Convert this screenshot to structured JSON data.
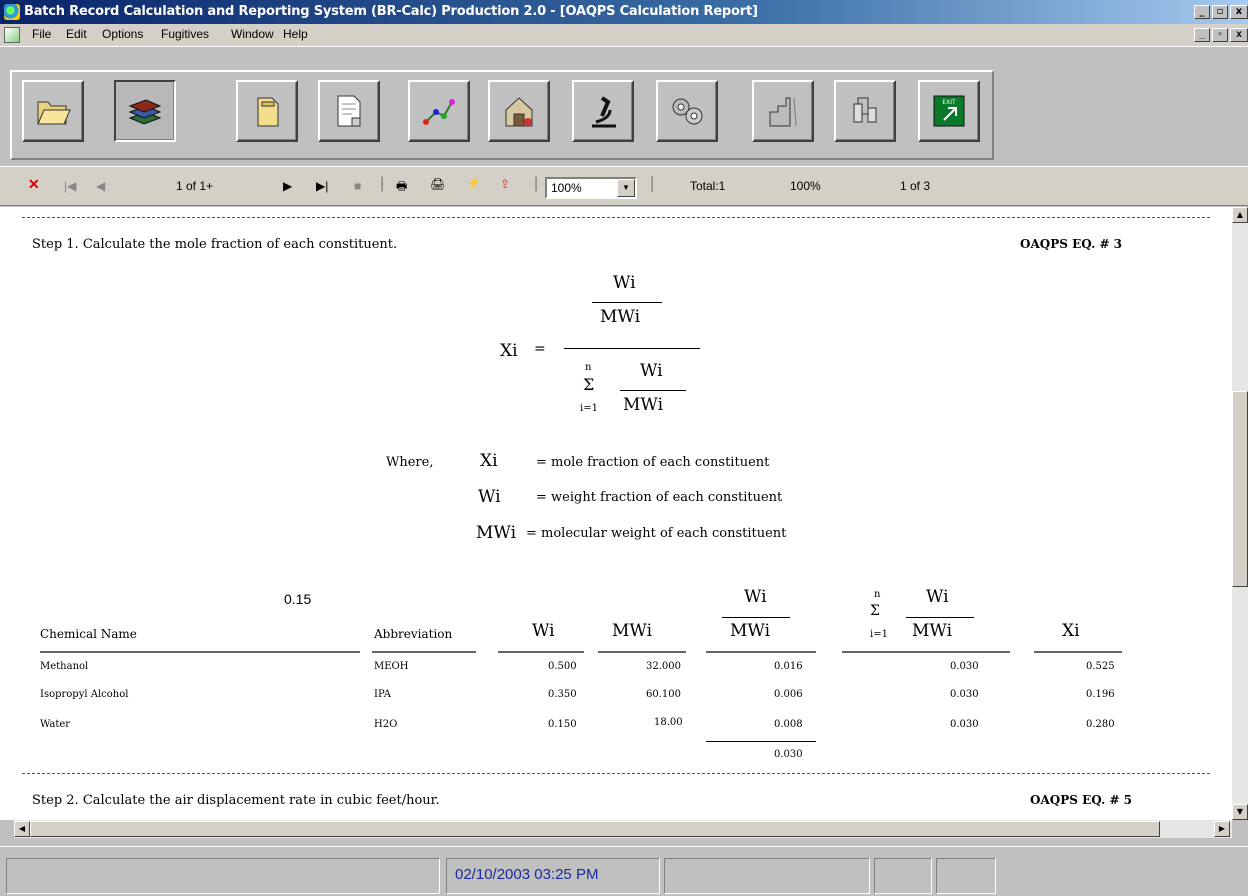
{
  "window": {
    "title": "Batch Record Calculation and Reporting System (BR-Calc) Production 2.0 - [OAQPS Calculation Report]"
  },
  "menu": {
    "items": [
      "File",
      "Edit",
      "Options",
      "Fugitives",
      "Window",
      "Help"
    ]
  },
  "toolbar": {
    "buttons": [
      "open-folder-icon",
      "books-icon",
      "folder-icon",
      "document-icon",
      "molecule-icon",
      "building-icon",
      "microscope-icon",
      "gears-icon",
      "factory-icon",
      "equipment-icon",
      "exit-icon"
    ],
    "exit_label": "EXIT"
  },
  "nav": {
    "page": "1 of 1+",
    "zoom": "100%",
    "total": "Total:1",
    "percent": "100%",
    "of": "1 of 3"
  },
  "report": {
    "step1": "Step 1.  Calculate the mole fraction of each constituent.",
    "eq1": "OAQPS EQ. # 3",
    "formula": {
      "lhs": "Xi",
      "eq": "=",
      "num": "Wi",
      "den": "MWi",
      "sum": "Σ",
      "n": "n",
      "i1": "i=1",
      "snum": "Wi",
      "sden": "MWi"
    },
    "where": "Where,",
    "defs": [
      {
        "sym": "Xi",
        "text": "= mole fraction of each constituent"
      },
      {
        "sym": "Wi",
        "text": "= weight fraction of each constituent"
      },
      {
        "sym": "MWi",
        "text": "= molecular weight of each constituent"
      }
    ],
    "stray_value": "0.15",
    "headers": {
      "chem": "Chemical Name",
      "abbr": "Abbreviation",
      "w": "Wi",
      "mw": "MWi",
      "wmw_num": "Wi",
      "wmw_den": "MWi",
      "sum_n": "n",
      "sum": "Σ",
      "sum_i": "i=1",
      "swmw_num": "Wi",
      "swmw_den": "MWi",
      "x": "Xi"
    },
    "rows": [
      {
        "name": "Methanol",
        "abbr": "MEOH",
        "w": "0.500",
        "mw": "32.000",
        "wmw": "0.016",
        "sum": "0.030",
        "x": "0.525"
      },
      {
        "name": "Isopropyl Alcohol",
        "abbr": "IPA",
        "w": "0.350",
        "mw": "60.100",
        "wmw": "0.006",
        "sum": "0.030",
        "x": "0.196"
      },
      {
        "name": "Water",
        "abbr": "H2O",
        "w": "0.150",
        "mw": "18.00",
        "wmw": "0.008",
        "sum": "0.030",
        "x": "0.280"
      }
    ],
    "total": "0.030",
    "step2": "Step 2.  Calculate the air displacement rate in cubic feet/hour.",
    "eq2": "OAQPS EQ. # 5"
  },
  "status": {
    "datetime": "02/10/2003  03:25 PM"
  }
}
